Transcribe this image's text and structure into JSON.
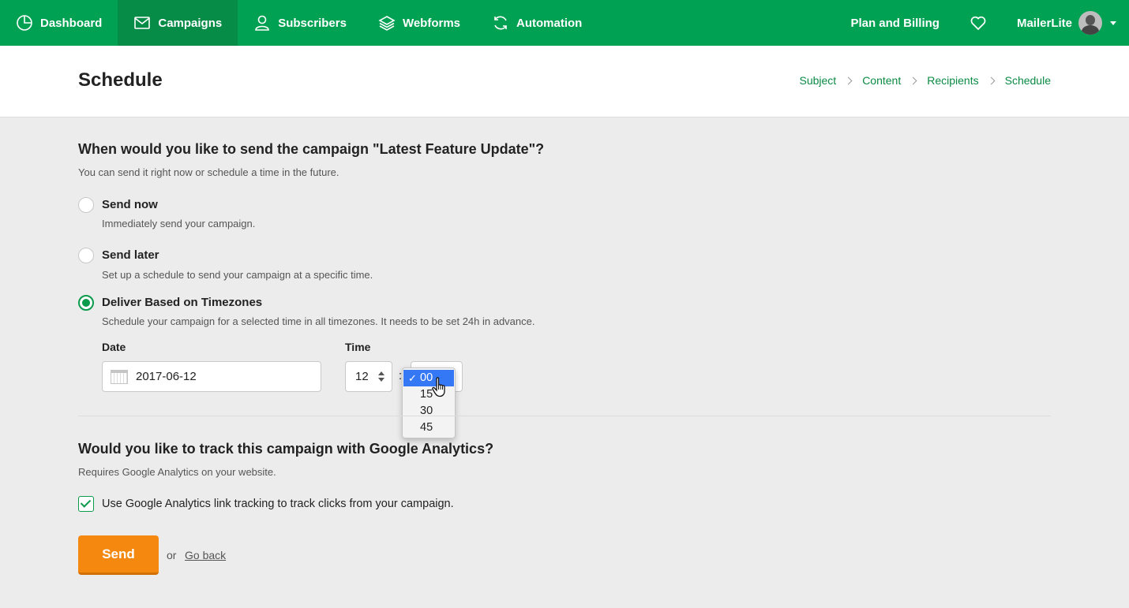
{
  "nav": {
    "items": [
      {
        "label": "Dashboard",
        "icon": "dashboard-icon",
        "active": false
      },
      {
        "label": "Campaigns",
        "icon": "envelope-icon",
        "active": true
      },
      {
        "label": "Subscribers",
        "icon": "user-icon",
        "active": false
      },
      {
        "label": "Webforms",
        "icon": "layers-icon",
        "active": false
      },
      {
        "label": "Automation",
        "icon": "refresh-icon",
        "active": false
      }
    ],
    "plan_billing": "Plan and Billing",
    "account_name": "MailerLite",
    "accent_color": "#00a152"
  },
  "header": {
    "title": "Schedule",
    "breadcrumb": [
      "Subject",
      "Content",
      "Recipients",
      "Schedule"
    ]
  },
  "schedule": {
    "question": "When would you like to send the campaign \"Latest Feature Update\"?",
    "subtitle": "You can send it right now or schedule a time in the future.",
    "options": [
      {
        "title": "Send now",
        "desc": "Immediately send your campaign.",
        "checked": false
      },
      {
        "title": "Send later",
        "desc": "Set up a schedule to send your campaign at a specific time.",
        "checked": false
      },
      {
        "title": "Deliver Based on Timezones",
        "desc": "Schedule your campaign for a selected time in all timezones. It needs to be set 24h in advance.",
        "checked": true
      }
    ],
    "date_label": "Date",
    "date_value": "2017-06-12",
    "time_label": "Time",
    "hour_value": "12",
    "colon": ":",
    "minute_options": [
      "00",
      "15",
      "30",
      "45"
    ],
    "minute_selected": "00",
    "check_mark": "✓"
  },
  "analytics": {
    "question": "Would you like to track this campaign with Google Analytics?",
    "subtitle": "Requires Google Analytics on your website.",
    "checkbox_label": "Use Google Analytics link tracking to track clicks from your campaign.",
    "checked": true
  },
  "actions": {
    "send_label": "Send",
    "or_text": "or",
    "go_back_label": "Go back",
    "send_color": "#f5880f"
  }
}
